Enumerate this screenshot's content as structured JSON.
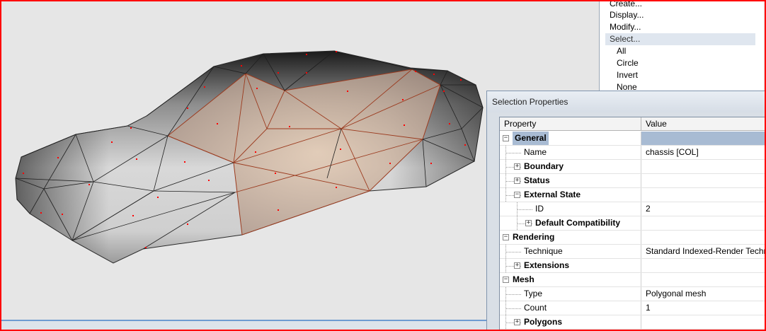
{
  "menu": {
    "items": [
      {
        "label": "Create..."
      },
      {
        "label": "Display..."
      },
      {
        "label": "Modify..."
      },
      {
        "label": "Select..."
      }
    ],
    "submenu": [
      {
        "label": "All"
      },
      {
        "label": "Circle"
      },
      {
        "label": "Invert"
      },
      {
        "label": "None"
      }
    ]
  },
  "dialog": {
    "title": "Selection Properties",
    "columns": {
      "property": "Property",
      "value": "Value"
    },
    "rows": [
      {
        "label": "General",
        "value": "",
        "level": 0,
        "expander": "-",
        "bold": true,
        "category": true
      },
      {
        "label": "Name",
        "value": "chassis [COL]",
        "level": 1,
        "expander": "",
        "bold": false
      },
      {
        "label": "Boundary",
        "value": "",
        "level": 1,
        "expander": "+",
        "bold": true
      },
      {
        "label": "Status",
        "value": "",
        "level": 1,
        "expander": "+",
        "bold": true
      },
      {
        "label": "External State",
        "value": "",
        "level": 1,
        "expander": "-",
        "bold": true
      },
      {
        "label": "ID",
        "value": "2",
        "level": 2,
        "expander": "",
        "bold": false
      },
      {
        "label": "Default Compatibility",
        "value": "",
        "level": 2,
        "expander": "+",
        "bold": true
      },
      {
        "label": "Rendering",
        "value": "",
        "level": 0,
        "expander": "-",
        "bold": true,
        "category": true
      },
      {
        "label": "Technique",
        "value": "Standard Indexed-Render Technique",
        "level": 1,
        "expander": "",
        "bold": false
      },
      {
        "label": "Extensions",
        "value": "",
        "level": 1,
        "expander": "+",
        "bold": true
      },
      {
        "label": "Mesh",
        "value": "",
        "level": 0,
        "expander": "-",
        "bold": true,
        "category": true
      },
      {
        "label": "Type",
        "value": "Polygonal mesh",
        "level": 1,
        "expander": "",
        "bold": false
      },
      {
        "label": "Count",
        "value": "1",
        "level": 1,
        "expander": "",
        "bold": false
      },
      {
        "label": "Polygons",
        "value": "",
        "level": 1,
        "expander": "+",
        "bold": true
      }
    ]
  },
  "colors": {
    "frame": "#ff0000",
    "selection": "#a8bbd3",
    "vertex": "#ff0000",
    "selected_edge": "#9b3a1e"
  }
}
